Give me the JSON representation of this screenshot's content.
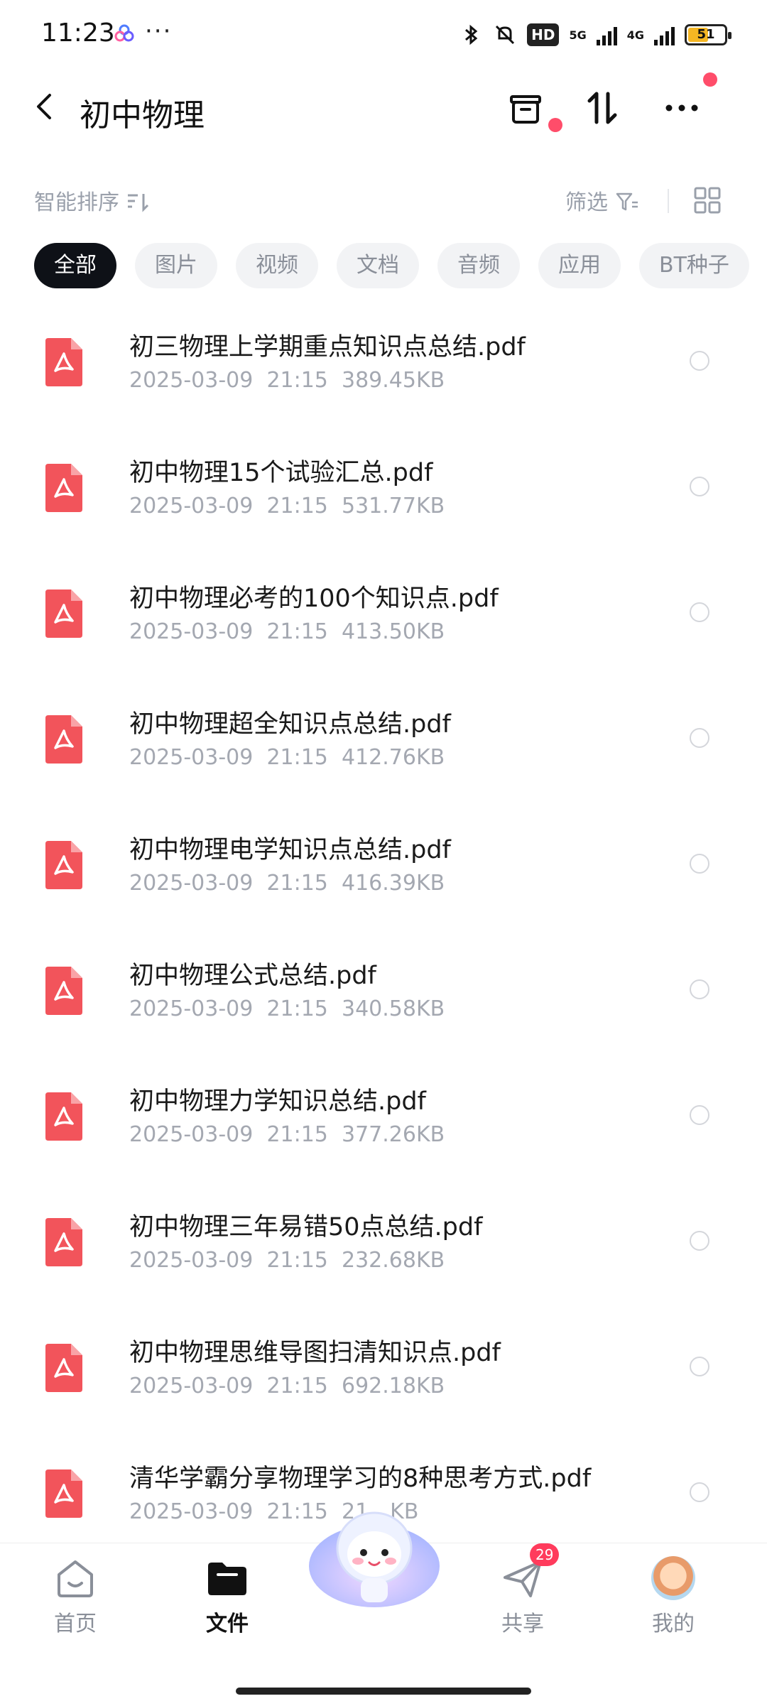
{
  "status_bar": {
    "time": "11:23",
    "more": "···",
    "hd": "HD",
    "net1": "5G",
    "net2": "4G",
    "battery_level": "51"
  },
  "header": {
    "title": "初中物理"
  },
  "toolbar": {
    "sort_label": "智能排序",
    "filter_label": "筛选"
  },
  "chips": [
    {
      "label": "全部",
      "active": true
    },
    {
      "label": "图片"
    },
    {
      "label": "视频"
    },
    {
      "label": "文档"
    },
    {
      "label": "音频"
    },
    {
      "label": "应用"
    },
    {
      "label": "BT种子"
    }
  ],
  "files": [
    {
      "name": "初三物理上学期重点知识点总结.pdf",
      "date": "2025-03-09",
      "time": "21:15",
      "size": "389.45KB"
    },
    {
      "name": "初中物理15个试验汇总.pdf",
      "date": "2025-03-09",
      "time": "21:15",
      "size": "531.77KB"
    },
    {
      "name": "初中物理必考的100个知识点.pdf",
      "date": "2025-03-09",
      "time": "21:15",
      "size": "413.50KB"
    },
    {
      "name": "初中物理超全知识点总结.pdf",
      "date": "2025-03-09",
      "time": "21:15",
      "size": "412.76KB"
    },
    {
      "name": "初中物理电学知识点总结.pdf",
      "date": "2025-03-09",
      "time": "21:15",
      "size": "416.39KB"
    },
    {
      "name": "初中物理公式总结.pdf",
      "date": "2025-03-09",
      "time": "21:15",
      "size": "340.58KB"
    },
    {
      "name": "初中物理力学知识总结.pdf",
      "date": "2025-03-09",
      "time": "21:15",
      "size": "377.26KB"
    },
    {
      "name": "初中物理三年易错50点总结.pdf",
      "date": "2025-03-09",
      "time": "21:15",
      "size": "232.68KB"
    },
    {
      "name": "初中物理思维导图扫清知识点.pdf",
      "date": "2025-03-09",
      "time": "21:15",
      "size": "692.18KB"
    },
    {
      "name": "清华学霸分享物理学习的8种思考方式.pdf",
      "date": "2025-03-09",
      "time": "21:15",
      "size": "21…KB"
    }
  ],
  "bottom_nav": {
    "home": "首页",
    "files": "文件",
    "share": "共享",
    "share_badge": "29",
    "me": "我的"
  },
  "colors": {
    "accent_red": "#ff4d6a",
    "pdf_red": "#f2545b",
    "chip_active_bg": "#0e1117"
  },
  "icons": [
    "back-icon",
    "trash-icon",
    "sort-arrows-icon",
    "more-icon",
    "filter-icon",
    "grid-view-icon",
    "pdf-icon",
    "home-icon",
    "folder-icon",
    "send-icon"
  ]
}
